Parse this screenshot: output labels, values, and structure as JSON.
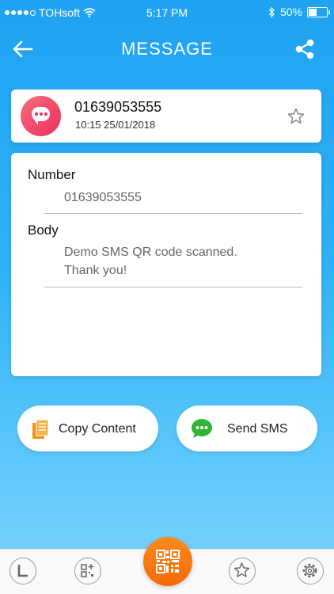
{
  "status_bar": {
    "carrier": "TOHsoft",
    "time": "5:17 PM",
    "battery": "50%",
    "battery_level": 0.5
  },
  "header": {
    "title": "MESSAGE",
    "back_icon": "back-arrow-icon",
    "share_icon": "share-icon"
  },
  "summary": {
    "number": "01639053555",
    "datetime": "10:15 25/01/2018",
    "avatar_icon": "sms-bubble-icon",
    "favorite_icon": "star-outline-icon"
  },
  "detail": {
    "number_label": "Number",
    "number_value": "01639053555",
    "body_label": "Body",
    "body_line1": "Demo SMS  QR code scanned.",
    "body_line2": "Thank you!"
  },
  "actions": {
    "copy_label": "Copy Content",
    "send_label": "Send SMS"
  },
  "tabbar": {
    "items": [
      "history-icon",
      "create-qr-icon",
      "scan-qr-icon",
      "favorites-icon",
      "settings-icon"
    ]
  },
  "colors": {
    "accent_blue": "#1fa3f2",
    "avatar_pink": "#ea2f5d",
    "scan_orange": "#f46a05",
    "sms_green": "#2db633",
    "copy_orange": "#f39415"
  }
}
